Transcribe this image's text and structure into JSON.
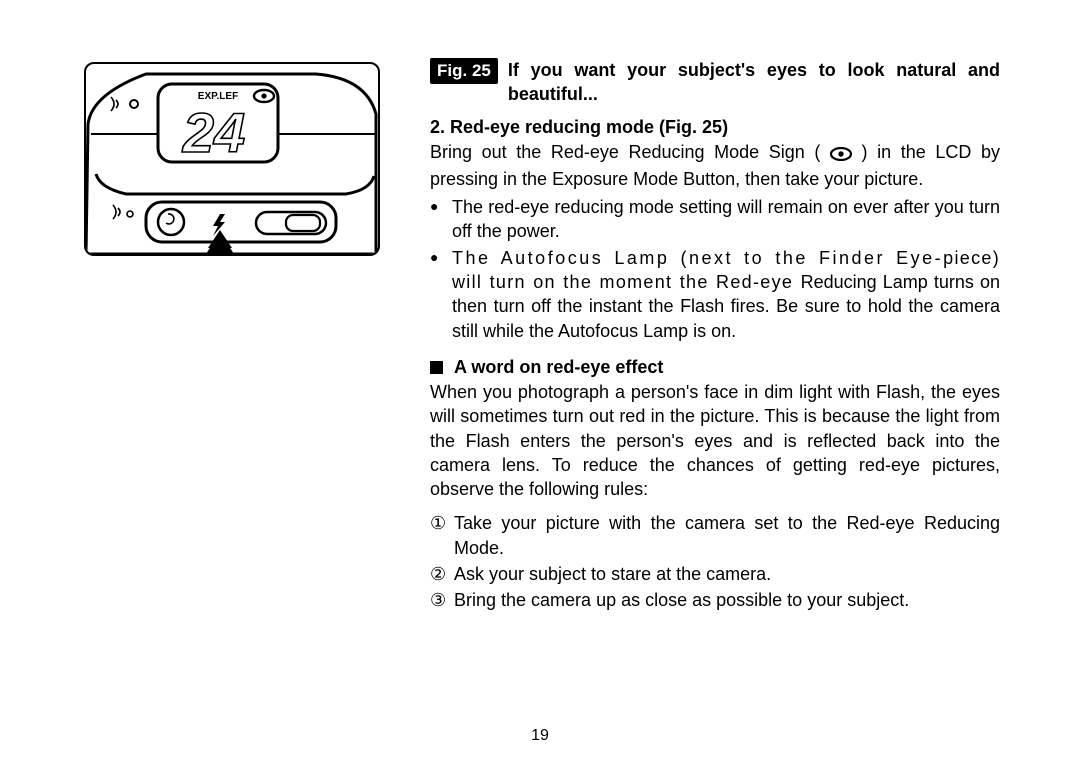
{
  "figure": {
    "label": "Fig. 25",
    "lcd_text_top": "EXP.LEF",
    "lcd_counter": "24"
  },
  "text": {
    "lead": "If you want your subject's eyes to look natural and beautiful...",
    "section_number_title": "2. Red-eye reducing mode (Fig. 25)",
    "intro_a": "Bring out the Red-eye Reducing Mode Sign (",
    "intro_b": ") in the LCD by pressing in the Exposure Mode Button, then take your picture.",
    "bullets": [
      "The red-eye reducing mode setting will remain on ever after you turn off the power.",
      "The Autofocus Lamp (next to the Finder Eye-piece) will turn on the moment the Red-eye Reducing Lamp turns on then turn off the instant the Flash fires. Be sure to hold the camera still while the Autofocus Lamp is on."
    ],
    "subheading": "A word on red-eye effect",
    "redeye_para": "When you photograph a person's face in dim light with Flash, the eyes will sometimes turn out red in the picture. This is because the light from the Flash enters the person's eyes and is reflected back into the camera lens. To reduce the chances of getting red-eye pictures, observe the following rules:",
    "steps": [
      "Take your picture with the camera set to the Red-eye Reducing Mode.",
      "Ask your subject to stare at the camera.",
      "Bring the camera up as close as possible to your subject."
    ],
    "step_glyphs": [
      "①",
      "②",
      "③"
    ]
  },
  "page_number": "19"
}
